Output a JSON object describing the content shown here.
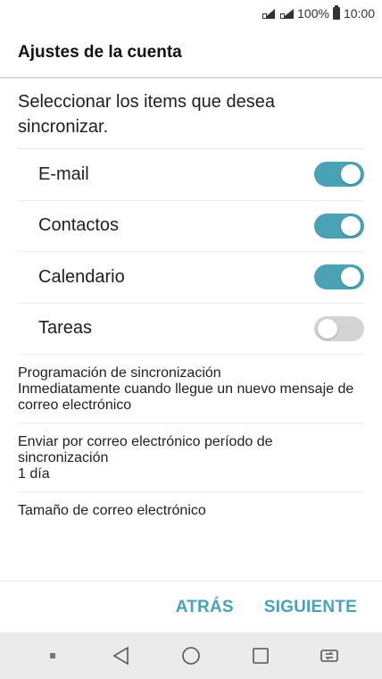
{
  "status_bar": {
    "battery_percent": "100%",
    "time": "10:00"
  },
  "header": {
    "title": "Ajustes de la cuenta"
  },
  "intro": {
    "text": "Seleccionar los items que desea sincronizar."
  },
  "sync_items": [
    {
      "label": "E-mail",
      "enabled": true
    },
    {
      "label": "Contactos",
      "enabled": true
    },
    {
      "label": "Calendario",
      "enabled": true
    },
    {
      "label": "Tareas",
      "enabled": false
    }
  ],
  "settings": [
    {
      "title": "Programación de sincronización",
      "subtitle": "Inmediatamente cuando llegue un nuevo mensaje de correo electrónico"
    },
    {
      "title": "Enviar por correo electrónico período de sincronización",
      "subtitle": "1 día"
    },
    {
      "title": "Tamaño de correo electrónico",
      "subtitle": ""
    }
  ],
  "footer": {
    "back_label": "ATRÁS",
    "next_label": "SIGUIENTE"
  },
  "colors": {
    "accent": "#4aa3b5",
    "toggle_off": "#d4d4d4",
    "nav_bg": "#ebebeb"
  }
}
